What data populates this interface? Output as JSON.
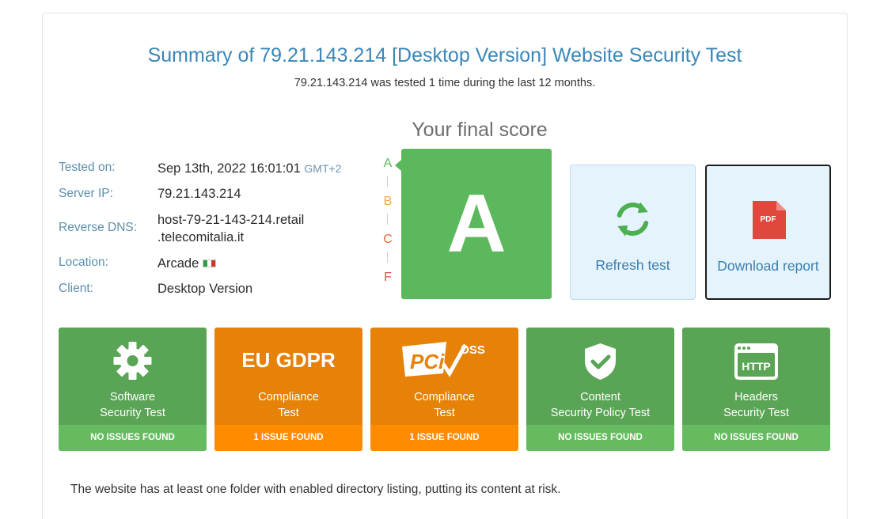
{
  "header": {
    "title": "Summary of 79.21.143.214 [Desktop Version] Website Security Test",
    "subtitle": "79.21.143.214 was tested 1 time during the last 12 months."
  },
  "info": {
    "tested_on_label": "Tested on:",
    "tested_on_value": "Sep 13th, 2022 16:01:01",
    "tested_on_tz": "GMT+2",
    "server_ip_label": "Server IP:",
    "server_ip_value": "79.21.143.214",
    "reverse_dns_label": "Reverse DNS:",
    "reverse_dns_line1": "host-79-21-143-214.retail",
    "reverse_dns_line2": ".telecomitalia.it",
    "location_label": "Location:",
    "location_value": "Arcade",
    "location_flag": "italy-flag",
    "client_label": "Client:",
    "client_value": "Desktop Version"
  },
  "score": {
    "title": "Your final score",
    "grade": "A",
    "scale": [
      "A",
      "B",
      "C",
      "F"
    ],
    "scale_colors": [
      "#5cb85c",
      "#f0a850",
      "#e06a3a",
      "#d9534f"
    ],
    "grade_color": "#5cb85c"
  },
  "actions": {
    "refresh_label": "Refresh test",
    "download_label": "Download report",
    "pdf_text": "PDF"
  },
  "tests": [
    {
      "line1": "Software",
      "line2": "Security Test",
      "status": "NO ISSUES FOUND",
      "icon": "gear-icon",
      "color": "green"
    },
    {
      "logo": "EU GDPR",
      "line1": "Compliance",
      "line2": "Test",
      "status": "1 ISSUE FOUND",
      "icon": "eu-gdpr-logo",
      "color": "orange"
    },
    {
      "logo": "DSS",
      "line1": "Compliance",
      "line2": "Test",
      "status": "1 ISSUE FOUND",
      "icon": "pci-dss-logo",
      "color": "orange"
    },
    {
      "line1": "Content",
      "line2": "Security Policy Test",
      "status": "NO ISSUES FOUND",
      "icon": "shield-check-icon",
      "color": "green"
    },
    {
      "logo": "HTTP",
      "line1": "Headers",
      "line2": "Security Test",
      "status": "NO ISSUES FOUND",
      "icon": "http-browser-icon",
      "color": "green"
    }
  ],
  "footer": {
    "text": "The website has at least one folder with enabled directory listing, putting its content at risk."
  }
}
